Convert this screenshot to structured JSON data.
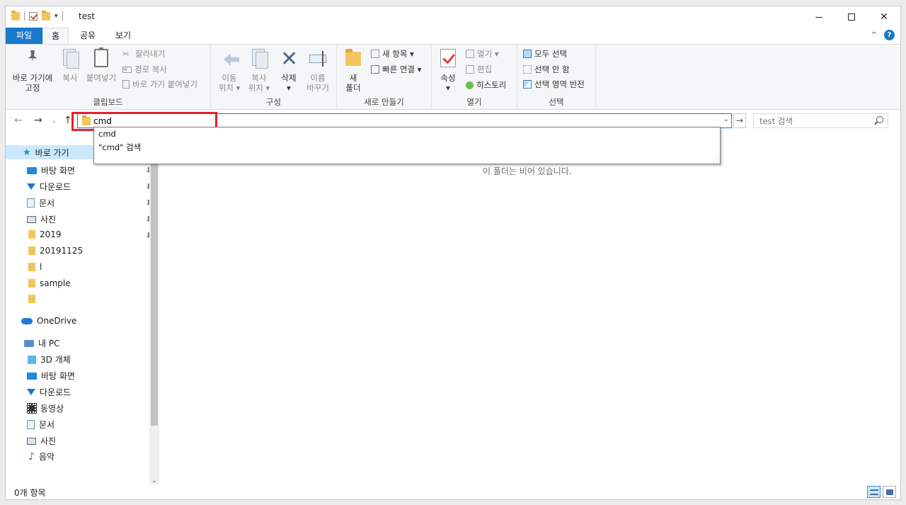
{
  "window": {
    "title": "test"
  },
  "ribbon_tabs": {
    "file": "파일",
    "home": "홈",
    "share": "공유",
    "view": "보기"
  },
  "clipboard": {
    "pin": "바로 가기에\n고정",
    "copy": "복사",
    "paste": "붙여넣기",
    "cut": "잘라내기",
    "copy_path": "경로 복사",
    "paste_shortcut": "바로 가기 붙여넣기",
    "label": "클립보드"
  },
  "organize": {
    "move_to": "이동\n위치 ▾",
    "copy_to": "복사\n위치 ▾",
    "delete": "삭제\n▾",
    "rename": "이름\n바꾸기",
    "label": "구성"
  },
  "new": {
    "new_folder": "새\n폴더",
    "new_item": "새 항목 ▾",
    "easy_access": "빠른 연결 ▾",
    "label": "새로 만들기"
  },
  "open": {
    "properties": "속성\n▾",
    "open": "열기 ▾",
    "edit": "편집",
    "history": "히스토리",
    "label": "열기"
  },
  "select": {
    "select_all": "모두 선택",
    "select_none": "선택 안 함",
    "invert": "선택 영역 반전",
    "label": "선택"
  },
  "address": {
    "value": "cmd"
  },
  "search": {
    "placeholder": "test 검색"
  },
  "autocomplete": [
    "cmd",
    "\"cmd\" 검색"
  ],
  "nav_pane": {
    "quick_access": "바로 가기",
    "quick_items": [
      "바탕 화면",
      "다운로드",
      "문서",
      "사진",
      "2019",
      "20191125",
      "l",
      "sample",
      ""
    ],
    "onedrive": "OneDrive",
    "this_pc": "내 PC",
    "pc_items": [
      "3D 개체",
      "바탕 화면",
      "다운로드",
      "동영상",
      "문서",
      "사진",
      "음악"
    ]
  },
  "content": {
    "empty_message": "이 폴더는 비어 있습니다."
  },
  "status": {
    "item_count": "0개 항목"
  },
  "colors": {
    "accent": "#1979ca",
    "highlight": "#e8202a",
    "selected": "#cce8ff"
  }
}
